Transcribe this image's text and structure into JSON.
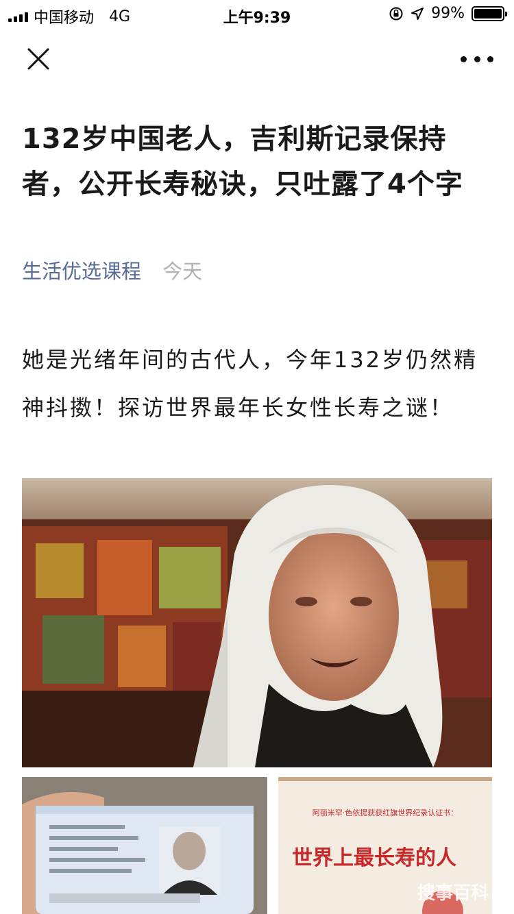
{
  "status_bar": {
    "carrier": "中国移动",
    "network": "4G",
    "time": "上午9:39",
    "battery_percent": "99%",
    "battery_level": 0.99
  },
  "nav": {
    "close_icon": "close-icon",
    "more_icon": "more-icon"
  },
  "article": {
    "title": "132岁中国老人，吉利斯记录保持者，公开长寿秘诀，只吐露了4个字",
    "account": "生活优选课程",
    "date": "今天",
    "lead": "她是光绪年间的古代人，今年132岁仍然精神抖擞！探访世界最年长女性长寿之谜！",
    "certificate_header": "阿丽米罕·色依提获获红旗世界纪录认证书：",
    "certificate_text": "世界上最长寿的人",
    "watermark": "搜事百科"
  },
  "colors": {
    "account_link": "#576b95",
    "date_gray": "#b2b2b2",
    "cert_red": "#c8282a"
  }
}
